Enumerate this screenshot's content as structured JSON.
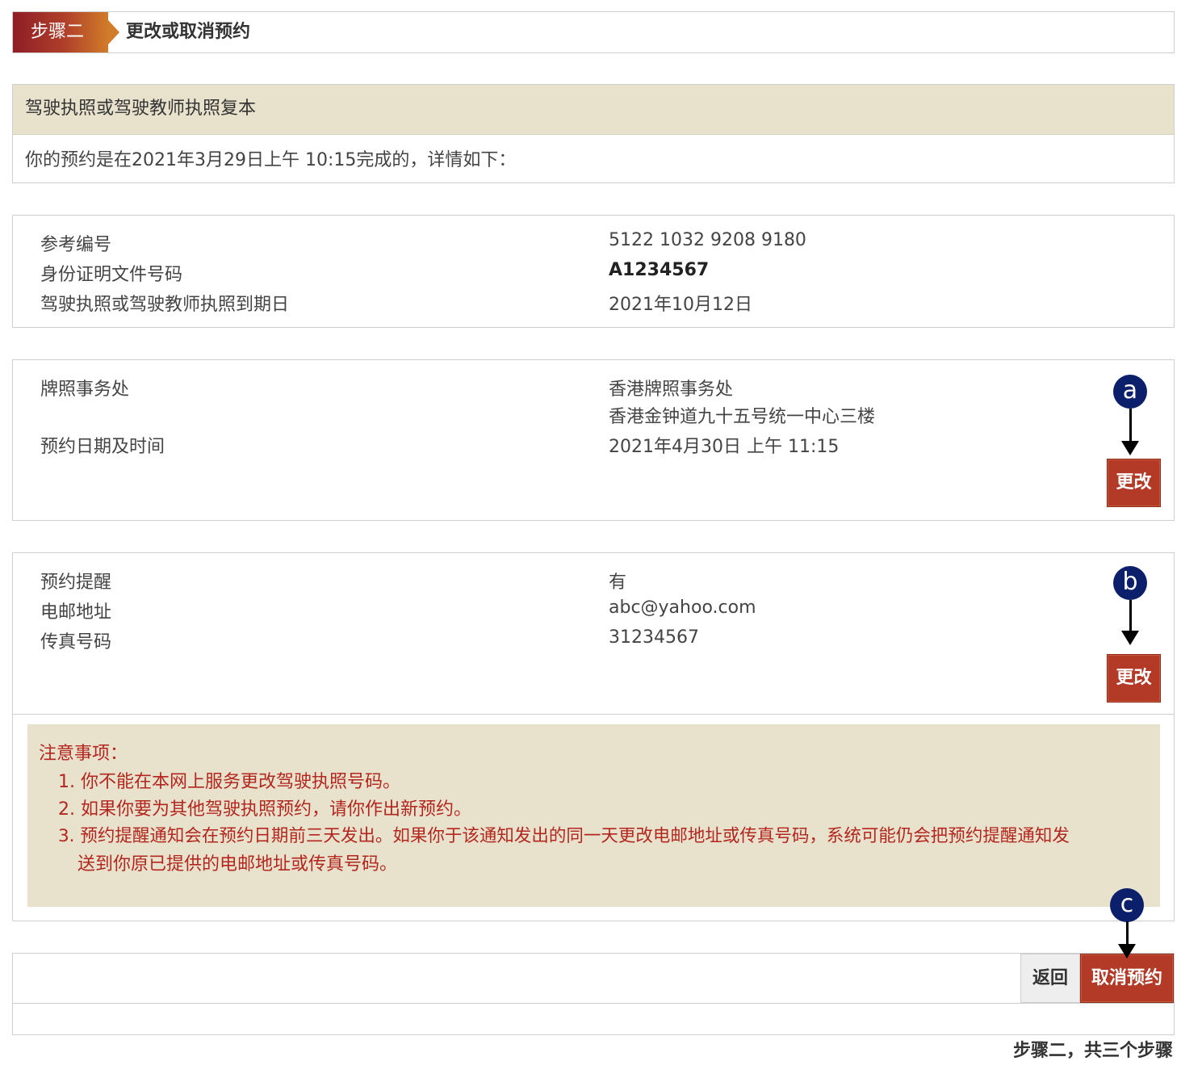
{
  "step": {
    "badge": "步骤二",
    "title": "更改或取消预约"
  },
  "intro": {
    "heading": "驾驶执照或驾驶教师执照复本",
    "text": "你的预约是在2021年3月29日上午 10:15完成的，详情如下："
  },
  "details": {
    "rows": [
      {
        "label": "参考编号",
        "value": "5122 1032 9208 9180"
      },
      {
        "label": "身份证明文件号码",
        "value": "A1234567"
      },
      {
        "label": "驾驶执照或驾驶教师执照到期日",
        "value": "2021年10月12日"
      }
    ]
  },
  "appointment": {
    "office_label": "牌照事务处",
    "office_name": "香港牌照事务处",
    "office_address": "香港金钟道九十五号统一中心三楼",
    "datetime_label": "预约日期及时间",
    "datetime_value": "2021年4月30日 上午 11:15",
    "change_label": "更改",
    "marker": "a"
  },
  "reminder": {
    "rows": [
      {
        "label": "预约提醒",
        "value": "有"
      },
      {
        "label": "电邮地址",
        "value": "abc@yahoo.com"
      },
      {
        "label": "传真号码",
        "value": "31234567"
      }
    ],
    "change_label": "更改",
    "marker": "b"
  },
  "notice": {
    "title": "注意事项：",
    "items": [
      "1. 你不能在本网上服务更改驾驶执照号码。",
      "2. 如果你要为其他驾驶执照预约，请你作出新预约。",
      "3. 预约提醒通知会在预约日期前三天发出。如果你于该通知发出的同一天更改电邮地址或传真号码，系统可能仍会把预约提醒通知发",
      "送到你原已提供的电邮地址或传真号码。"
    ]
  },
  "actions": {
    "back_label": "返回",
    "cancel_label": "取消预约",
    "marker": "c"
  },
  "footer": {
    "progress": "步骤二，共三个步骤"
  }
}
